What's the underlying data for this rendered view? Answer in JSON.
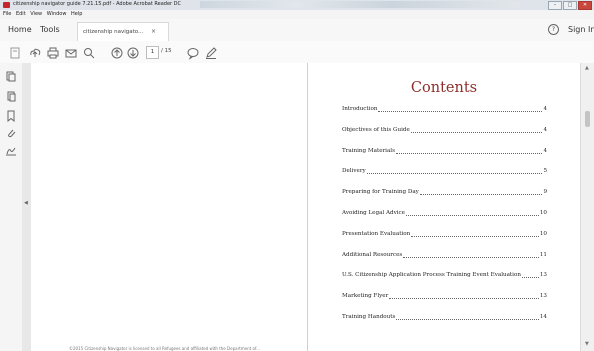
{
  "window": {
    "title": "citizenship navigator guide 7.21.15.pdf - Adobe Acrobat Reader DC",
    "buttons": {
      "minimize": "–",
      "maximize": "□",
      "close": "✕"
    }
  },
  "menu": [
    "File",
    "Edit",
    "View",
    "Window",
    "Help"
  ],
  "nav": {
    "home": "Home",
    "tools": "Tools",
    "doc_tab": "citizenship navigato...",
    "tab_close": "×",
    "help": "?",
    "sign_in": "Sign In"
  },
  "toolbar": {
    "page_current": "1",
    "page_total": "/ 15",
    "icons": [
      "save-icon",
      "upload-icon",
      "print-icon",
      "email-icon",
      "search-icon",
      "page-up-icon",
      "page-down-icon",
      "comment-icon",
      "pen-icon"
    ]
  },
  "side_panel_icons": [
    "attachment-icon",
    "layers-icon",
    "bookmark-icon",
    "paperclip-icon",
    "signature-icon"
  ],
  "document": {
    "left_page_footer": "©2015 Citizenship Navigator is licensed to all Refugees and affiliated with the Department of...",
    "contents_title": "Contents",
    "toc": [
      {
        "label": "Introduction",
        "page": "4"
      },
      {
        "label": "Objectives of this Guide",
        "page": "4"
      },
      {
        "label": "Training Materials",
        "page": "4"
      },
      {
        "label": "Delivery",
        "page": "5"
      },
      {
        "label": "Preparing for Training Day",
        "page": "9"
      },
      {
        "label": "Avoiding Legal Advice",
        "page": "10"
      },
      {
        "label": "Presentation Evaluation",
        "page": "10"
      },
      {
        "label": "Additional Resources",
        "page": "11"
      },
      {
        "label": "U.S. Citizenship Application Process Training Event Evaluation",
        "page": "13"
      },
      {
        "label": "Marketing Flyer",
        "page": "13"
      },
      {
        "label": "Training Handouts",
        "page": "14"
      }
    ]
  }
}
